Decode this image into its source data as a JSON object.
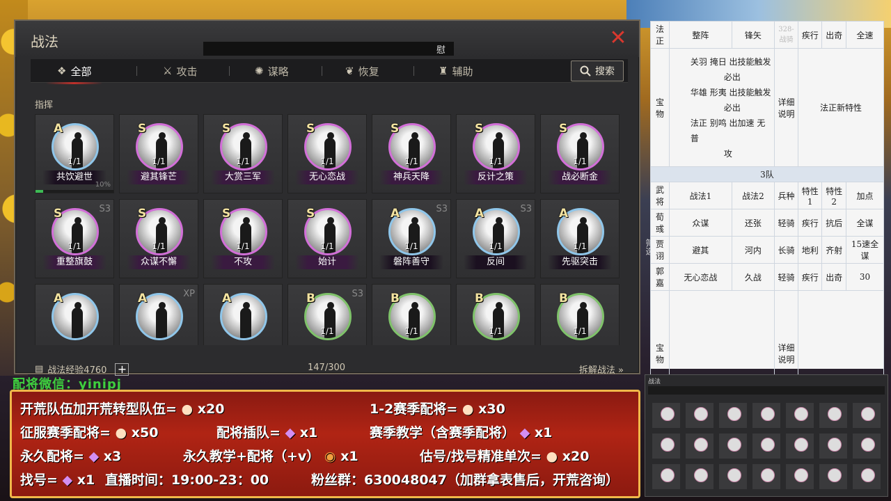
{
  "panel": {
    "title": "战法",
    "title_bar_text": "慰",
    "close_icon": "✕",
    "tabs": [
      {
        "label": "全部",
        "icon": "all-icon"
      },
      {
        "label": "攻击",
        "icon": "swords-icon"
      },
      {
        "label": "谋略",
        "icon": "strategy-icon"
      },
      {
        "label": "恢复",
        "icon": "recover-icon"
      },
      {
        "label": "辅助",
        "icon": "assist-icon"
      }
    ],
    "search_label": "搜索",
    "section_label": "指挥",
    "side_filter": "筛选",
    "cards": [
      {
        "grade": "A",
        "level": "1/1",
        "name": "共饮避世",
        "progress": 0.1,
        "progress_label": "10%"
      },
      {
        "grade": "S",
        "level": "1/1",
        "name": "避其锋芒"
      },
      {
        "grade": "S",
        "level": "1/1",
        "name": "大赏三军"
      },
      {
        "grade": "S",
        "level": "1/1",
        "name": "无心恋战"
      },
      {
        "grade": "S",
        "level": "1/1",
        "name": "神兵天降"
      },
      {
        "grade": "S",
        "level": "1/1",
        "name": "反计之策"
      },
      {
        "grade": "S",
        "level": "1/1",
        "name": "战必断金"
      },
      {
        "grade": "S",
        "level": "1/1",
        "name": "重整旗鼓",
        "tag": "S3"
      },
      {
        "grade": "S",
        "level": "1/1",
        "name": "众谋不懈"
      },
      {
        "grade": "S",
        "level": "1/1",
        "name": "不攻"
      },
      {
        "grade": "S",
        "level": "1/1",
        "name": "始计"
      },
      {
        "grade": "A",
        "level": "1/1",
        "name": "磐阵善守",
        "tag": "S3"
      },
      {
        "grade": "A",
        "level": "1/1",
        "name": "反间",
        "tag": "S3"
      },
      {
        "grade": "A",
        "level": "1/1",
        "name": "先驱突击"
      },
      {
        "grade": "A",
        "level": "",
        "name": ""
      },
      {
        "grade": "A",
        "level": "",
        "name": "",
        "tag": "XP"
      },
      {
        "grade": "A",
        "level": "",
        "name": ""
      },
      {
        "grade": "B",
        "level": "1/1",
        "name": "",
        "tag": "S3"
      },
      {
        "grade": "B",
        "level": "1/1",
        "name": ""
      },
      {
        "grade": "B",
        "level": "1/1",
        "name": ""
      },
      {
        "grade": "B",
        "level": "1/1",
        "name": ""
      }
    ],
    "footer": {
      "exp_label": "战法经验4760",
      "count": "147/300",
      "dismantle": "拆解战法 »"
    }
  },
  "sheet": {
    "header": [
      "法正",
      "整阵",
      "锋矢",
      "328-战骑",
      "疾行",
      "出奇",
      "全速"
    ],
    "team1_label": "宝物",
    "team1_lines": [
      "关羽 掩日 出技能触发",
      "必出",
      "华雄 形夷 出技能触发",
      "必出",
      "法正 别鸣 出加速 无普",
      "攻"
    ],
    "detail": "详细说明",
    "new_trait": "法正新特性",
    "team3_title": "3队",
    "team3_cols": [
      "武将",
      "战法1",
      "战法2",
      "兵种",
      "特性1",
      "特性2",
      "加点"
    ],
    "team3_rows": [
      [
        "荀彧",
        "众谋",
        "还张",
        "轻骑",
        "疾行",
        "抗后",
        "全谋"
      ],
      [
        "贾诩",
        "避其",
        "河内",
        "长骑",
        "地利",
        "齐射",
        "15速全谋"
      ],
      [
        "郭嘉",
        "无心恋战",
        "久战",
        "轻骑",
        "疾行",
        "出奇",
        "30"
      ]
    ],
    "team4_label": "宝物",
    "team4_detail": "详细说明"
  },
  "mini": {
    "title": "战法"
  },
  "promo": {
    "top": "配将微信：yinipj",
    "lines": [
      "开荒队伍加开荒转型队伍=",
      "x20",
      "1-2赛季配将=",
      "x30",
      "征服赛季配将=",
      "x50",
      "配将插队=",
      "x1",
      "赛季教学（含赛季配将）",
      "x1",
      "永久配将=",
      "x3",
      "永久教学+配将（+v）",
      "x1",
      "估号/找号精准单次=",
      "x20",
      "找号=",
      "x1",
      "直播时间：19:00-23：00",
      "粉丝群：630048047（加群拿表售后，开荒咨询）"
    ]
  }
}
